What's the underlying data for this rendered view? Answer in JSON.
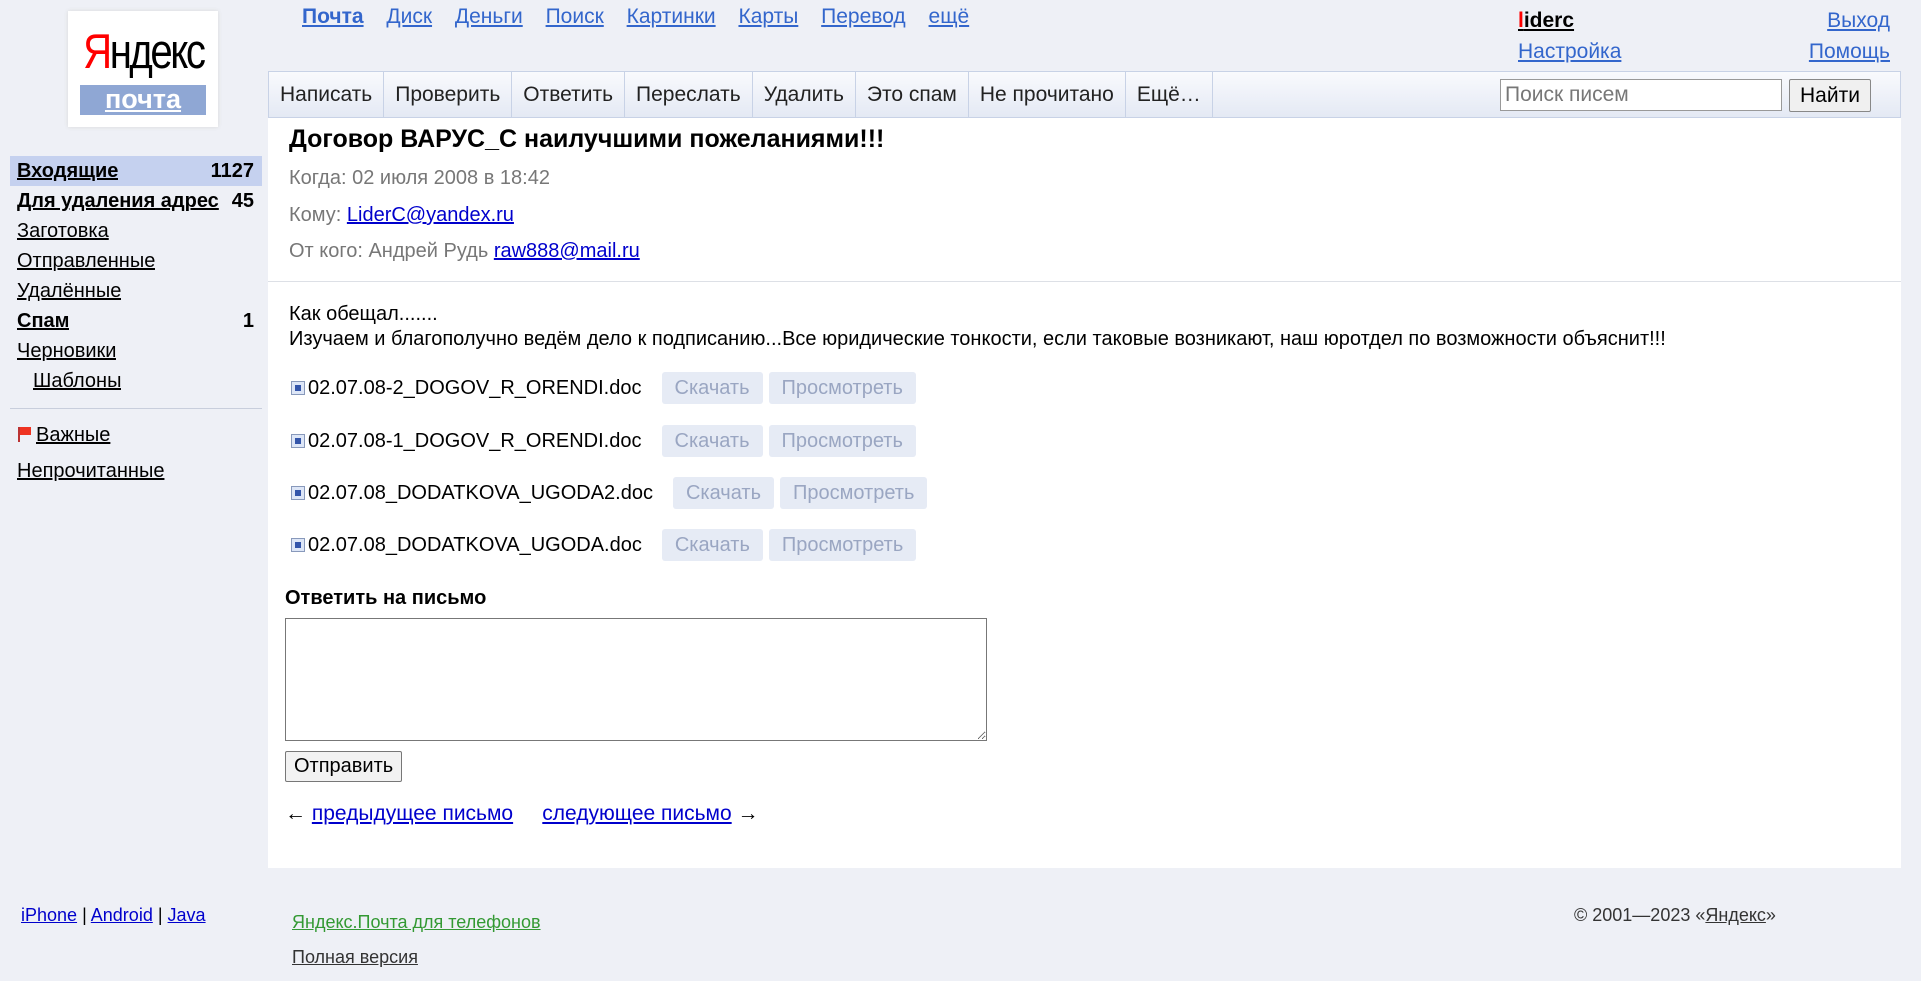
{
  "logo": {
    "first_letter": "Я",
    "rest": "ндекс",
    "sub": "почта"
  },
  "services": [
    "Почта",
    "Диск",
    "Деньги",
    "Поиск",
    "Картинки",
    "Карты",
    "Перевод",
    "ещё"
  ],
  "user": {
    "first_letter": "l",
    "rest": "iderc",
    "settings": "Настройка"
  },
  "header_right": {
    "logout": "Выход",
    "help": "Помощь"
  },
  "toolbar": {
    "buttons": [
      "Написать",
      "Проверить",
      "Ответить",
      "Переслать",
      "Удалить",
      "Это спам",
      "Не прочитано",
      "Ещё…"
    ],
    "search_placeholder": "Поиск писем",
    "search_button": "Найти"
  },
  "folders": [
    {
      "name": "Входящие",
      "count": "1127"
    },
    {
      "name": "Для удаления адрес",
      "count": "45"
    },
    {
      "name": "Заготовка",
      "count": ""
    },
    {
      "name": "Отправленные",
      "count": ""
    },
    {
      "name": "Удалённые",
      "count": ""
    },
    {
      "name": "Спам",
      "count": "1"
    },
    {
      "name": "Черновики",
      "count": ""
    },
    {
      "name": "Шаблоны",
      "count": ""
    }
  ],
  "special": {
    "important": "Важные",
    "unread": "Непрочитанные"
  },
  "message": {
    "subject": "Договор ВАРУС_С наилучшими пожеланиями!!!",
    "when_label": "Когда:",
    "when": "02 июля 2008 в 18:42",
    "to_label": "Кому:",
    "to": "LiderC@yandex.ru",
    "from_label": "От кого:",
    "from_name": "Андрей Рудь",
    "from_email": "raw888@mail.ru",
    "body_line1": "Как обещал.......",
    "body_line2": "Изучаем и благополучно ведём дело к подписанию...Все юридические тонкости, если таковые возникают, наш юротдел по возможности объяснит!!!"
  },
  "attachments": [
    {
      "name": "02.07.08-2_DOGOV_R_ORENDI.doc"
    },
    {
      "name": "02.07.08-1_DOGOV_R_ORENDI.doc"
    },
    {
      "name": "02.07.08_DODATKOVA_UGODA2.doc"
    },
    {
      "name": "02.07.08_DODATKOVA_UGODA.doc"
    }
  ],
  "attachment_actions": {
    "download": "Скачать",
    "view": "Просмотреть"
  },
  "reply": {
    "title": "Ответить на письмо",
    "send": "Отправить"
  },
  "pager": {
    "prev_arrow": "←",
    "prev": "предыдущее письмо",
    "next": "следующее письмо",
    "next_arrow": "→"
  },
  "footer": {
    "iphone": "iPhone",
    "android": "Android",
    "java": "Java",
    "sep": "|",
    "mobile": "Яндекс.Почта для телефонов",
    "full": "Полная версия",
    "copyright": "© 2001—2023 «",
    "yandex": "Яндекс",
    "copyright_end": "»"
  }
}
